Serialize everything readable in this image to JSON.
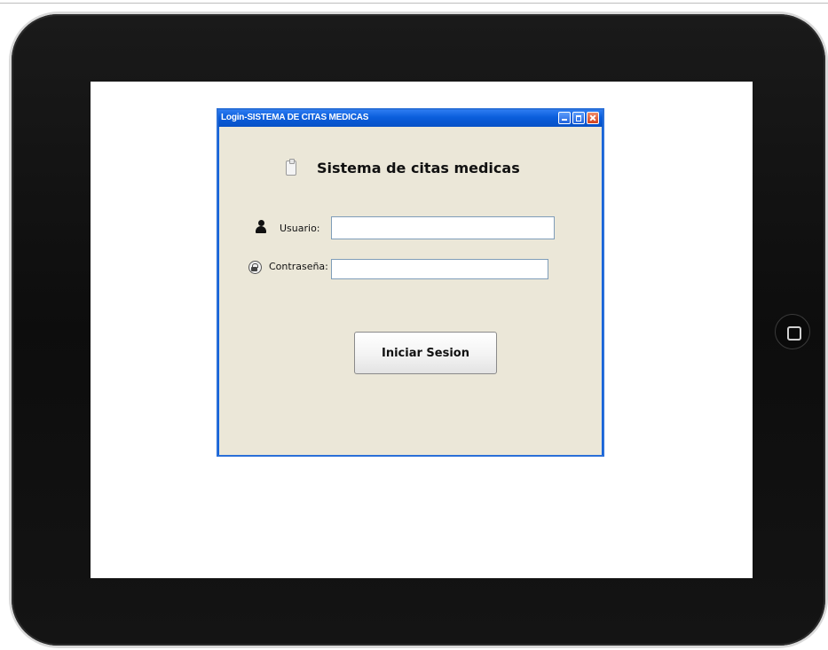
{
  "window": {
    "title": "Login-SISTEMA DE CITAS MEDICAS",
    "controls": [
      "minimize",
      "maximize",
      "close"
    ]
  },
  "form": {
    "heading": "Sistema de citas medicas",
    "heading_icon": "clipboard-icon",
    "username_label": "Usuario:",
    "username_icon": "user-icon",
    "username_value": "",
    "password_label": "Contraseña:",
    "password_icon": "lock-icon",
    "password_value": "",
    "submit_label": "Iniciar Sesion"
  },
  "colors": {
    "titlebar": "#0a5ddb",
    "client_bg": "#ebe7d8",
    "close_button": "#d2401c"
  }
}
